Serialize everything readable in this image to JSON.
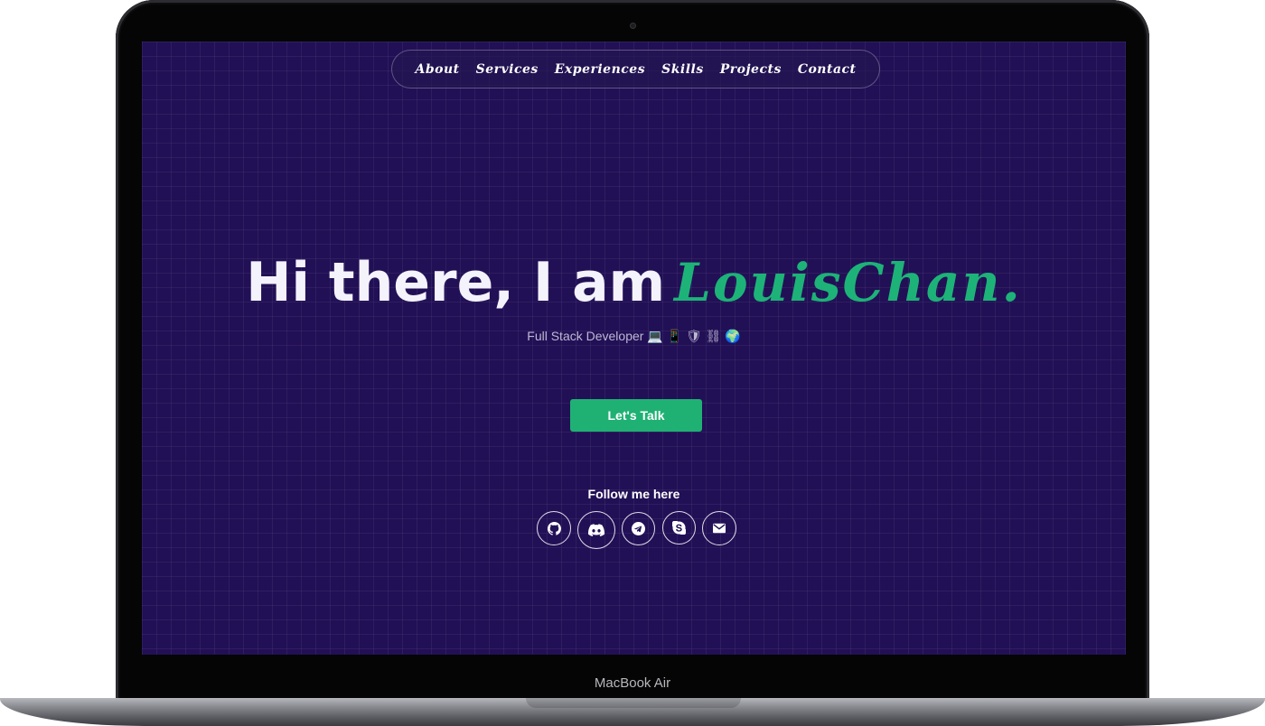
{
  "device": {
    "label": "MacBook Air"
  },
  "nav": {
    "items": [
      {
        "label": "About"
      },
      {
        "label": "Services"
      },
      {
        "label": "Experiences"
      },
      {
        "label": "Skills"
      },
      {
        "label": "Projects"
      },
      {
        "label": "Contact"
      }
    ]
  },
  "hero": {
    "greeting": "Hi there, I am",
    "name": "LouisChan.",
    "subtitle": "Full Stack Developer 💻 📱 🛡 ⛓ 🌍"
  },
  "cta": {
    "label": "Let's Talk"
  },
  "follow": {
    "title": "Follow me here",
    "icons": [
      "github-icon",
      "discord-icon",
      "telegram-icon",
      "skype-icon",
      "email-icon"
    ]
  },
  "colors": {
    "background": "#221056",
    "accent": "#1fb174",
    "name": "#1db378",
    "text": "#f4f2fb"
  }
}
